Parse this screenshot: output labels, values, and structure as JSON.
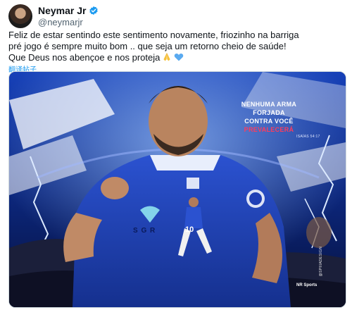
{
  "tweet": {
    "author": {
      "name": "Neymar Jr",
      "handle": "@neymarjr",
      "verified": true
    },
    "text_lines": [
      "Feliz de estar sentindo este sentimento novamente, friozinho na barriga",
      "pré jogo é sempre muito bom .. que seja um retorno cheio de saúde!",
      "Que Deus nos abençoe e nos proteja"
    ],
    "emojis": [
      "folded-hands",
      "blue-heart"
    ],
    "translate_label": "翻译帖子"
  },
  "media": {
    "poster": {
      "line1": "NENHUMA ARMA",
      "line2": "FORJADA",
      "line3": "CONTRA VOCÊ",
      "line4": "PREVALECERÁ",
      "reference": "ISAÍAS 54:17",
      "watermark": "NR Sports",
      "credit": "@SPIIIADESIGN"
    },
    "jersey_sponsor": "S G R",
    "jersey_number": "10"
  },
  "colors": {
    "accent": "#1d9bf0",
    "kit_blue": "#1f3fb5",
    "poster_red": "#ff3b5c"
  }
}
